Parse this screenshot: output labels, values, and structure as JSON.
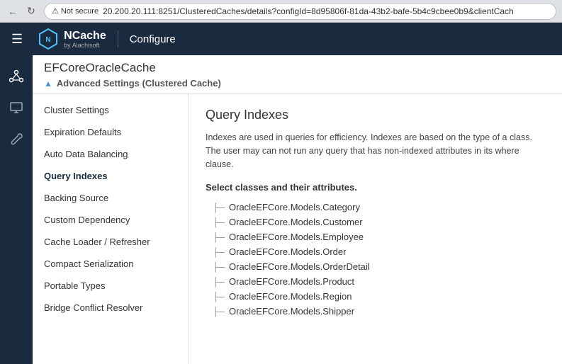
{
  "browser": {
    "back_icon": "←",
    "refresh_icon": "↻",
    "security_label": "Not secure",
    "url": "20.200.20.111:8251/ClusteredCaches/details?configId=8d95806f-81da-43b2-bafe-5b4c9cbee0b9&clientCach"
  },
  "topnav": {
    "menu_icon": "☰",
    "logo_text": "NCache",
    "logo_sub": "by Alachisoft",
    "title": "Configure"
  },
  "page": {
    "title": "EFCoreOracleCache",
    "section_toggle": "▲",
    "section_title": "Advanced Settings (Clustered Cache)"
  },
  "sidebar_icons": [
    {
      "name": "network-icon",
      "icon": "⬡"
    },
    {
      "name": "monitor-icon",
      "icon": "🖥"
    },
    {
      "name": "wrench-icon",
      "icon": "🔧"
    }
  ],
  "left_menu": {
    "items": [
      {
        "id": "cluster-settings",
        "label": "Cluster Settings",
        "active": false
      },
      {
        "id": "expiration-defaults",
        "label": "Expiration Defaults",
        "active": false
      },
      {
        "id": "auto-data-balancing",
        "label": "Auto Data Balancing",
        "active": false
      },
      {
        "id": "query-indexes",
        "label": "Query Indexes",
        "active": true
      },
      {
        "id": "backing-source",
        "label": "Backing Source",
        "active": false
      },
      {
        "id": "custom-dependency",
        "label": "Custom Dependency",
        "active": false
      },
      {
        "id": "cache-loader-refresher",
        "label": "Cache Loader / Refresher",
        "active": false
      },
      {
        "id": "compact-serialization",
        "label": "Compact Serialization",
        "active": false
      },
      {
        "id": "portable-types",
        "label": "Portable Types",
        "active": false
      },
      {
        "id": "bridge-conflict-resolver",
        "label": "Bridge Conflict Resolver",
        "active": false
      }
    ]
  },
  "content": {
    "title": "Query Indexes",
    "description": "Indexes are used in queries for efficiency. Indexes are based on the type of a class. The user may can not run any query that has non-indexed attributes in its where clause.",
    "select_label": "Select classes and their attributes.",
    "tree_items": [
      "OracleEFCore.Models.Category",
      "OracleEFCore.Models.Customer",
      "OracleEFCore.Models.Employee",
      "OracleEFCore.Models.Order",
      "OracleEFCore.Models.OrderDetail",
      "OracleEFCore.Models.Product",
      "OracleEFCore.Models.Region",
      "OracleEFCore.Models.Shipper"
    ],
    "tree_branch_char": "├─"
  }
}
